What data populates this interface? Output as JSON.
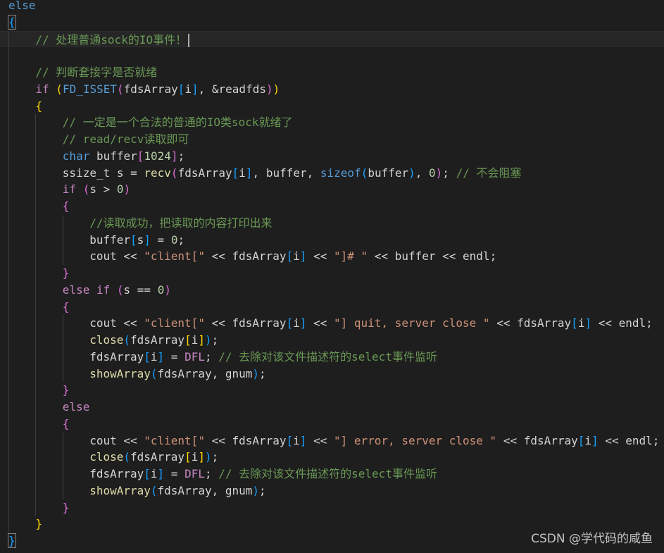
{
  "editor": {
    "lines": [
      {
        "indent": 0,
        "tokens": [
          [
            "kw",
            "else"
          ]
        ]
      },
      {
        "indent": 0,
        "tokens": [
          [
            "p3b",
            "{"
          ]
        ]
      },
      {
        "indent": 1,
        "current": true,
        "cursor": true,
        "tokens": [
          [
            "cm",
            "// 处理普通sock的IO事件！"
          ]
        ]
      },
      {
        "indent": 1,
        "tokens": []
      },
      {
        "indent": 1,
        "tokens": [
          [
            "cm",
            "// 判断套接字是否就绪"
          ]
        ]
      },
      {
        "indent": 1,
        "tokens": [
          [
            "ctl",
            "if"
          ],
          [
            "id",
            " "
          ],
          [
            "p1",
            "("
          ],
          [
            "mac",
            "FD_ISSET"
          ],
          [
            "p2",
            "("
          ],
          [
            "id",
            "fdsArray"
          ],
          [
            "p3",
            "["
          ],
          [
            "id",
            "i"
          ],
          [
            "p3",
            "]"
          ],
          [
            "id",
            ", &"
          ],
          [
            "id",
            "readfds"
          ],
          [
            "p2",
            ")"
          ],
          [
            "p1",
            ")"
          ]
        ]
      },
      {
        "indent": 1,
        "tokens": [
          [
            "p1",
            "{"
          ]
        ]
      },
      {
        "indent": 2,
        "tokens": [
          [
            "cm",
            "// 一定是一个合法的普通的IO类sock就绪了"
          ]
        ]
      },
      {
        "indent": 2,
        "tokens": [
          [
            "cm",
            "// read/recv读取即可"
          ]
        ]
      },
      {
        "indent": 2,
        "tokens": [
          [
            "kw",
            "char"
          ],
          [
            "id",
            " buffer"
          ],
          [
            "p2",
            "["
          ],
          [
            "num",
            "1024"
          ],
          [
            "p2",
            "]"
          ],
          [
            "id",
            ";"
          ]
        ]
      },
      {
        "indent": 2,
        "tokens": [
          [
            "id",
            "ssize_t s = "
          ],
          [
            "fn",
            "recv"
          ],
          [
            "p2",
            "("
          ],
          [
            "id",
            "fdsArray"
          ],
          [
            "p3",
            "["
          ],
          [
            "id",
            "i"
          ],
          [
            "p3",
            "]"
          ],
          [
            "id",
            ", buffer, "
          ],
          [
            "kw",
            "sizeof"
          ],
          [
            "p3",
            "("
          ],
          [
            "id",
            "buffer"
          ],
          [
            "p3",
            ")"
          ],
          [
            "id",
            ", "
          ],
          [
            "num",
            "0"
          ],
          [
            "p2",
            ")"
          ],
          [
            "id",
            "; "
          ],
          [
            "cm",
            "// 不会阻塞"
          ]
        ]
      },
      {
        "indent": 2,
        "tokens": [
          [
            "ctl",
            "if"
          ],
          [
            "id",
            " "
          ],
          [
            "p2",
            "("
          ],
          [
            "id",
            "s > "
          ],
          [
            "num",
            "0"
          ],
          [
            "p2",
            ")"
          ]
        ]
      },
      {
        "indent": 2,
        "tokens": [
          [
            "p2",
            "{"
          ]
        ]
      },
      {
        "indent": 3,
        "tokens": [
          [
            "cm",
            "//读取成功，把读取的内容打印出来"
          ]
        ]
      },
      {
        "indent": 3,
        "tokens": [
          [
            "id",
            "buffer"
          ],
          [
            "p3",
            "["
          ],
          [
            "id",
            "s"
          ],
          [
            "p3",
            "]"
          ],
          [
            "id",
            " = "
          ],
          [
            "num",
            "0"
          ],
          [
            "id",
            ";"
          ]
        ]
      },
      {
        "indent": 3,
        "tokens": [
          [
            "id",
            "cout << "
          ],
          [
            "str",
            "\"client[\""
          ],
          [
            "id",
            " << fdsArray"
          ],
          [
            "p3",
            "["
          ],
          [
            "id",
            "i"
          ],
          [
            "p3",
            "]"
          ],
          [
            "id",
            " << "
          ],
          [
            "str",
            "\"]# \""
          ],
          [
            "id",
            " << buffer << endl;"
          ]
        ]
      },
      {
        "indent": 2,
        "tokens": [
          [
            "p2",
            "}"
          ]
        ]
      },
      {
        "indent": 2,
        "tokens": [
          [
            "ctl",
            "else"
          ],
          [
            "id",
            " "
          ],
          [
            "ctl",
            "if"
          ],
          [
            "id",
            " "
          ],
          [
            "p2",
            "("
          ],
          [
            "id",
            "s == "
          ],
          [
            "num",
            "0"
          ],
          [
            "p2",
            ")"
          ]
        ]
      },
      {
        "indent": 2,
        "tokens": [
          [
            "p2",
            "{"
          ]
        ]
      },
      {
        "indent": 3,
        "tokens": [
          [
            "id",
            "cout << "
          ],
          [
            "str",
            "\"client[\""
          ],
          [
            "id",
            " << fdsArray"
          ],
          [
            "p3",
            "["
          ],
          [
            "id",
            "i"
          ],
          [
            "p3",
            "]"
          ],
          [
            "id",
            " << "
          ],
          [
            "str",
            "\"] quit, server close \""
          ],
          [
            "id",
            " << fdsArray"
          ],
          [
            "p3",
            "["
          ],
          [
            "id",
            "i"
          ],
          [
            "p3",
            "]"
          ],
          [
            "id",
            " << endl;"
          ]
        ]
      },
      {
        "indent": 3,
        "tokens": [
          [
            "fn",
            "close"
          ],
          [
            "p3",
            "("
          ],
          [
            "id",
            "fdsArray"
          ],
          [
            "p1",
            "["
          ],
          [
            "id",
            "i"
          ],
          [
            "p1",
            "]"
          ],
          [
            "p3",
            ")"
          ],
          [
            "id",
            ";"
          ]
        ]
      },
      {
        "indent": 3,
        "tokens": [
          [
            "id",
            "fdsArray"
          ],
          [
            "p3",
            "["
          ],
          [
            "id",
            "i"
          ],
          [
            "p3",
            "]"
          ],
          [
            "id",
            " = "
          ],
          [
            "en",
            "DFL"
          ],
          [
            "id",
            "; "
          ],
          [
            "cm",
            "// 去除对该文件描述符的select事件监听"
          ]
        ]
      },
      {
        "indent": 3,
        "tokens": [
          [
            "fn",
            "showArray"
          ],
          [
            "p3",
            "("
          ],
          [
            "id",
            "fdsArray, gnum"
          ],
          [
            "p3",
            ")"
          ],
          [
            "id",
            ";"
          ]
        ]
      },
      {
        "indent": 2,
        "tokens": [
          [
            "p2",
            "}"
          ]
        ]
      },
      {
        "indent": 2,
        "tokens": [
          [
            "ctl",
            "else"
          ]
        ]
      },
      {
        "indent": 2,
        "tokens": [
          [
            "p2",
            "{"
          ]
        ]
      },
      {
        "indent": 3,
        "tokens": [
          [
            "id",
            "cout << "
          ],
          [
            "str",
            "\"client[\""
          ],
          [
            "id",
            " << fdsArray"
          ],
          [
            "p3",
            "["
          ],
          [
            "id",
            "i"
          ],
          [
            "p3",
            "]"
          ],
          [
            "id",
            " << "
          ],
          [
            "str",
            "\"] error, server close \""
          ],
          [
            "id",
            " << fdsArray"
          ],
          [
            "p3",
            "["
          ],
          [
            "id",
            "i"
          ],
          [
            "p3",
            "]"
          ],
          [
            "id",
            " << endl;"
          ]
        ]
      },
      {
        "indent": 3,
        "tokens": [
          [
            "fn",
            "close"
          ],
          [
            "p3",
            "("
          ],
          [
            "id",
            "fdsArray"
          ],
          [
            "p1",
            "["
          ],
          [
            "id",
            "i"
          ],
          [
            "p1",
            "]"
          ],
          [
            "p3",
            ")"
          ],
          [
            "id",
            ";"
          ]
        ]
      },
      {
        "indent": 3,
        "tokens": [
          [
            "id",
            "fdsArray"
          ],
          [
            "p3",
            "["
          ],
          [
            "id",
            "i"
          ],
          [
            "p3",
            "]"
          ],
          [
            "id",
            " = "
          ],
          [
            "en",
            "DFL"
          ],
          [
            "id",
            "; "
          ],
          [
            "cm",
            "// 去除对该文件描述符的select事件监听"
          ]
        ]
      },
      {
        "indent": 3,
        "tokens": [
          [
            "fn",
            "showArray"
          ],
          [
            "p3",
            "("
          ],
          [
            "id",
            "fdsArray, gnum"
          ],
          [
            "p3",
            ")"
          ],
          [
            "id",
            ";"
          ]
        ]
      },
      {
        "indent": 2,
        "tokens": [
          [
            "p2",
            "}"
          ]
        ]
      },
      {
        "indent": 1,
        "tokens": [
          [
            "p1",
            "}"
          ]
        ]
      },
      {
        "indent": 0,
        "tokens": [
          [
            "p3b",
            "}"
          ]
        ]
      }
    ]
  },
  "watermark": "CSDN @学代码的咸鱼"
}
